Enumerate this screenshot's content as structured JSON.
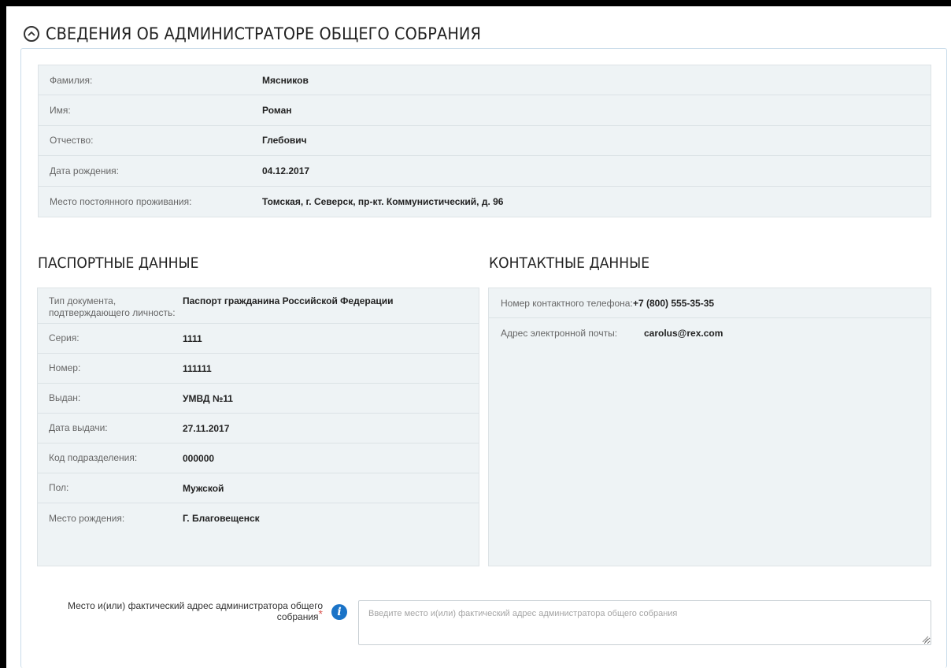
{
  "section": {
    "title": "СВЕДЕНИЯ ОБ АДМИНИСТРАТОРЕ ОБЩЕГО СОБРАНИЯ",
    "icon": "chevron-up-circle-icon"
  },
  "person": {
    "rows": [
      {
        "label": "Фамилия:",
        "value": "Мясников"
      },
      {
        "label": "Имя:",
        "value": "Роман"
      },
      {
        "label": "Отчество:",
        "value": "Глебович"
      },
      {
        "label": "Дата рождения:",
        "value": "04.12.2017"
      },
      {
        "label": "Место постоянного проживания:",
        "value": "Томская, г. Северск, пр-кт. Коммунистический, д. 96"
      }
    ]
  },
  "passport": {
    "heading": "ПАСПОРТНЫЕ ДАННЫЕ",
    "rows": [
      {
        "label": "Тип документа, подтверждающего личность:",
        "value": "Паспорт гражданина Российской Федерации"
      },
      {
        "label": "Серия:",
        "value": "1111"
      },
      {
        "label": "Номер:",
        "value": "111111"
      },
      {
        "label": "Выдан:",
        "value": "УМВД №11"
      },
      {
        "label": "Дата выдачи:",
        "value": "27.11.2017"
      },
      {
        "label": "Код подразделения:",
        "value": "000000"
      },
      {
        "label": "Пол:",
        "value": "Мужской"
      },
      {
        "label": "Место рождения:",
        "value": "Г. Благовещенск"
      }
    ]
  },
  "contacts": {
    "heading": "КОНТАКТНЫЕ ДАННЫЕ",
    "rows": [
      {
        "label": "Номер контактного телефона:",
        "value": "+7 (800) 555-35-35"
      },
      {
        "label": "Адрес электронной почты:",
        "value": "carolus@rex.com"
      }
    ]
  },
  "address_field": {
    "label": "Место и(или) фактический адрес администратора общего собрания",
    "required_mark": "*",
    "value": "",
    "placeholder": "Введите место и(или) фактический адрес администратора общего собрания",
    "info_icon": "info-icon",
    "info_glyph": "i"
  },
  "colors": {
    "panel_bg": "#eef3f5",
    "panel_border": "#c9dcea",
    "info_icon": "#1a73c7",
    "required": "#d9534f"
  }
}
